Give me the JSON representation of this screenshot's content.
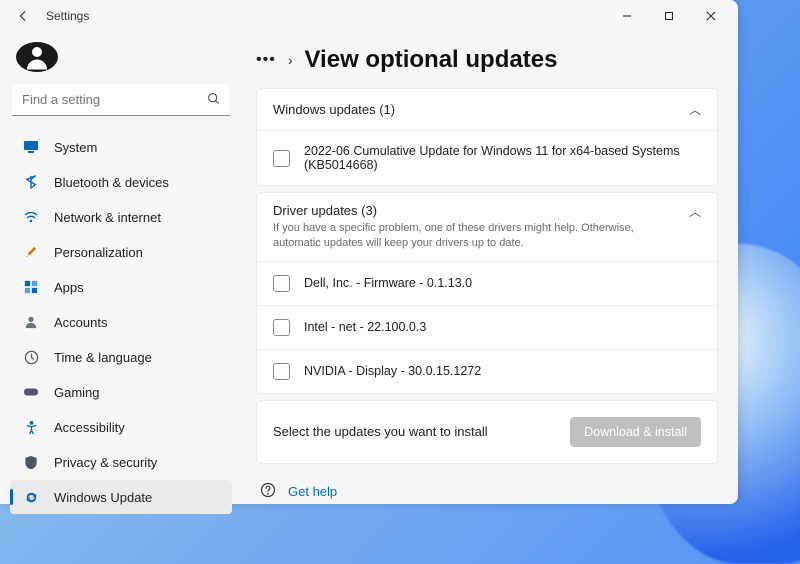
{
  "window": {
    "title": "Settings"
  },
  "search": {
    "placeholder": "Find a setting"
  },
  "nav": {
    "items": [
      {
        "icon": "monitor",
        "label": "System"
      },
      {
        "icon": "bluetooth",
        "label": "Bluetooth & devices"
      },
      {
        "icon": "wifi",
        "label": "Network & internet"
      },
      {
        "icon": "brush",
        "label": "Personalization"
      },
      {
        "icon": "grid",
        "label": "Apps"
      },
      {
        "icon": "person",
        "label": "Accounts"
      },
      {
        "icon": "globe-clock",
        "label": "Time & language"
      },
      {
        "icon": "gamepad",
        "label": "Gaming"
      },
      {
        "icon": "accessibility",
        "label": "Accessibility"
      },
      {
        "icon": "shield",
        "label": "Privacy & security"
      },
      {
        "icon": "update",
        "label": "Windows Update",
        "selected": true
      }
    ]
  },
  "page": {
    "title": "View optional updates"
  },
  "sections": {
    "windows": {
      "title": "Windows updates (1)",
      "items": [
        {
          "label": "2022-06 Cumulative Update for Windows 11 for x64-based Systems (KB5014668)"
        }
      ]
    },
    "drivers": {
      "title": "Driver updates (3)",
      "subtitle": "If you have a specific problem, one of these drivers might help. Otherwise, automatic updates will keep your drivers up to date.",
      "items": [
        {
          "label": "Dell, Inc. - Firmware - 0.1.13.0"
        },
        {
          "label": "Intel - net - 22.100.0.3"
        },
        {
          "label": "NVIDIA - Display - 30.0.15.1272"
        }
      ]
    }
  },
  "install": {
    "prompt": "Select the updates you want to install",
    "button": "Download & install"
  },
  "help": {
    "label": "Get help"
  },
  "colors": {
    "accent": "#0067c0"
  }
}
